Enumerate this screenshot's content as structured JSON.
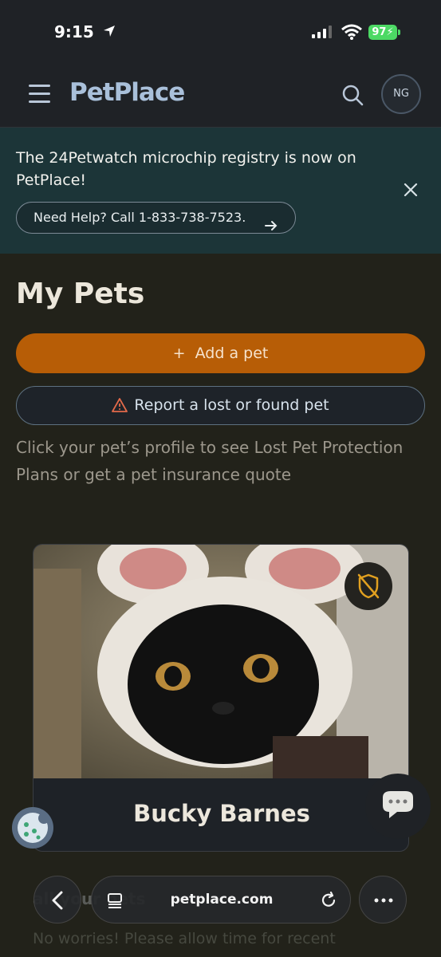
{
  "status_bar": {
    "time": "9:15",
    "battery": "97"
  },
  "header": {
    "logo": "PetPlace",
    "avatar_initials": "NG"
  },
  "banner": {
    "message": "The 24Petwatch microchip registry is now on PetPlace!",
    "help_label": "Need Help? Call 1-833-738-7523."
  },
  "main": {
    "title": "My Pets",
    "add_pet_label": "Add a pet",
    "report_pet_label": "Report a lost or found pet",
    "hint": "Click your pet’s profile to see Lost Pet Protection Plans or get a pet insurance quote"
  },
  "pets": [
    {
      "name": "Bucky Barnes"
    }
  ],
  "below": {
    "partial_heading": "all your pets",
    "partial_text": "No worries! Please allow time for recent"
  },
  "browser": {
    "url": "petplace.com"
  },
  "colors": {
    "background": "#22221a",
    "header": "#1f2226",
    "banner": "#1c3538",
    "primary_button": "#b75d06",
    "logo": "#a9c0da"
  }
}
